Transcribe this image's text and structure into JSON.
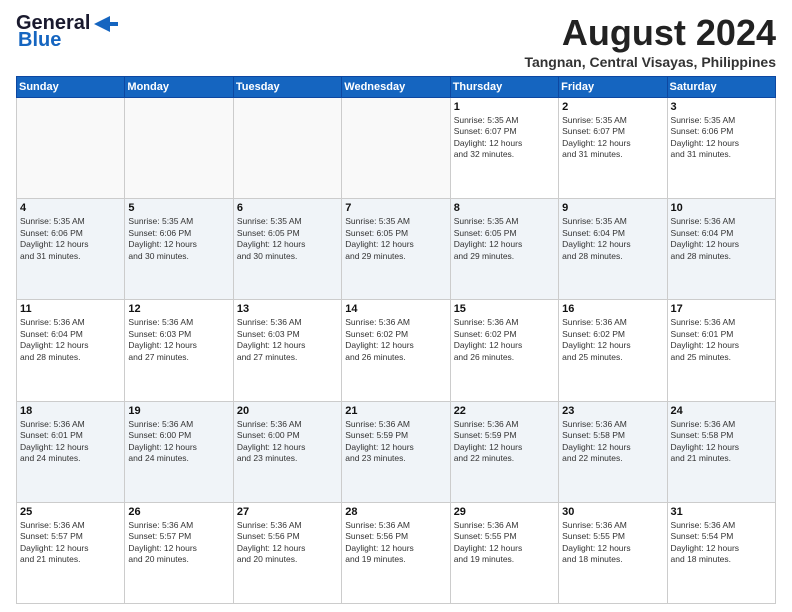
{
  "logo": {
    "line1": "General",
    "line2": "Blue"
  },
  "title": "August 2024",
  "location": "Tangnan, Central Visayas, Philippines",
  "days_of_week": [
    "Sunday",
    "Monday",
    "Tuesday",
    "Wednesday",
    "Thursday",
    "Friday",
    "Saturday"
  ],
  "weeks": [
    [
      {
        "day": "",
        "info": ""
      },
      {
        "day": "",
        "info": ""
      },
      {
        "day": "",
        "info": ""
      },
      {
        "day": "",
        "info": ""
      },
      {
        "day": "1",
        "info": "Sunrise: 5:35 AM\nSunset: 6:07 PM\nDaylight: 12 hours\nand 32 minutes."
      },
      {
        "day": "2",
        "info": "Sunrise: 5:35 AM\nSunset: 6:07 PM\nDaylight: 12 hours\nand 31 minutes."
      },
      {
        "day": "3",
        "info": "Sunrise: 5:35 AM\nSunset: 6:06 PM\nDaylight: 12 hours\nand 31 minutes."
      }
    ],
    [
      {
        "day": "4",
        "info": "Sunrise: 5:35 AM\nSunset: 6:06 PM\nDaylight: 12 hours\nand 31 minutes."
      },
      {
        "day": "5",
        "info": "Sunrise: 5:35 AM\nSunset: 6:06 PM\nDaylight: 12 hours\nand 30 minutes."
      },
      {
        "day": "6",
        "info": "Sunrise: 5:35 AM\nSunset: 6:05 PM\nDaylight: 12 hours\nand 30 minutes."
      },
      {
        "day": "7",
        "info": "Sunrise: 5:35 AM\nSunset: 6:05 PM\nDaylight: 12 hours\nand 29 minutes."
      },
      {
        "day": "8",
        "info": "Sunrise: 5:35 AM\nSunset: 6:05 PM\nDaylight: 12 hours\nand 29 minutes."
      },
      {
        "day": "9",
        "info": "Sunrise: 5:35 AM\nSunset: 6:04 PM\nDaylight: 12 hours\nand 28 minutes."
      },
      {
        "day": "10",
        "info": "Sunrise: 5:36 AM\nSunset: 6:04 PM\nDaylight: 12 hours\nand 28 minutes."
      }
    ],
    [
      {
        "day": "11",
        "info": "Sunrise: 5:36 AM\nSunset: 6:04 PM\nDaylight: 12 hours\nand 28 minutes."
      },
      {
        "day": "12",
        "info": "Sunrise: 5:36 AM\nSunset: 6:03 PM\nDaylight: 12 hours\nand 27 minutes."
      },
      {
        "day": "13",
        "info": "Sunrise: 5:36 AM\nSunset: 6:03 PM\nDaylight: 12 hours\nand 27 minutes."
      },
      {
        "day": "14",
        "info": "Sunrise: 5:36 AM\nSunset: 6:02 PM\nDaylight: 12 hours\nand 26 minutes."
      },
      {
        "day": "15",
        "info": "Sunrise: 5:36 AM\nSunset: 6:02 PM\nDaylight: 12 hours\nand 26 minutes."
      },
      {
        "day": "16",
        "info": "Sunrise: 5:36 AM\nSunset: 6:02 PM\nDaylight: 12 hours\nand 25 minutes."
      },
      {
        "day": "17",
        "info": "Sunrise: 5:36 AM\nSunset: 6:01 PM\nDaylight: 12 hours\nand 25 minutes."
      }
    ],
    [
      {
        "day": "18",
        "info": "Sunrise: 5:36 AM\nSunset: 6:01 PM\nDaylight: 12 hours\nand 24 minutes."
      },
      {
        "day": "19",
        "info": "Sunrise: 5:36 AM\nSunset: 6:00 PM\nDaylight: 12 hours\nand 24 minutes."
      },
      {
        "day": "20",
        "info": "Sunrise: 5:36 AM\nSunset: 6:00 PM\nDaylight: 12 hours\nand 23 minutes."
      },
      {
        "day": "21",
        "info": "Sunrise: 5:36 AM\nSunset: 5:59 PM\nDaylight: 12 hours\nand 23 minutes."
      },
      {
        "day": "22",
        "info": "Sunrise: 5:36 AM\nSunset: 5:59 PM\nDaylight: 12 hours\nand 22 minutes."
      },
      {
        "day": "23",
        "info": "Sunrise: 5:36 AM\nSunset: 5:58 PM\nDaylight: 12 hours\nand 22 minutes."
      },
      {
        "day": "24",
        "info": "Sunrise: 5:36 AM\nSunset: 5:58 PM\nDaylight: 12 hours\nand 21 minutes."
      }
    ],
    [
      {
        "day": "25",
        "info": "Sunrise: 5:36 AM\nSunset: 5:57 PM\nDaylight: 12 hours\nand 21 minutes."
      },
      {
        "day": "26",
        "info": "Sunrise: 5:36 AM\nSunset: 5:57 PM\nDaylight: 12 hours\nand 20 minutes."
      },
      {
        "day": "27",
        "info": "Sunrise: 5:36 AM\nSunset: 5:56 PM\nDaylight: 12 hours\nand 20 minutes."
      },
      {
        "day": "28",
        "info": "Sunrise: 5:36 AM\nSunset: 5:56 PM\nDaylight: 12 hours\nand 19 minutes."
      },
      {
        "day": "29",
        "info": "Sunrise: 5:36 AM\nSunset: 5:55 PM\nDaylight: 12 hours\nand 19 minutes."
      },
      {
        "day": "30",
        "info": "Sunrise: 5:36 AM\nSunset: 5:55 PM\nDaylight: 12 hours\nand 18 minutes."
      },
      {
        "day": "31",
        "info": "Sunrise: 5:36 AM\nSunset: 5:54 PM\nDaylight: 12 hours\nand 18 minutes."
      }
    ]
  ]
}
